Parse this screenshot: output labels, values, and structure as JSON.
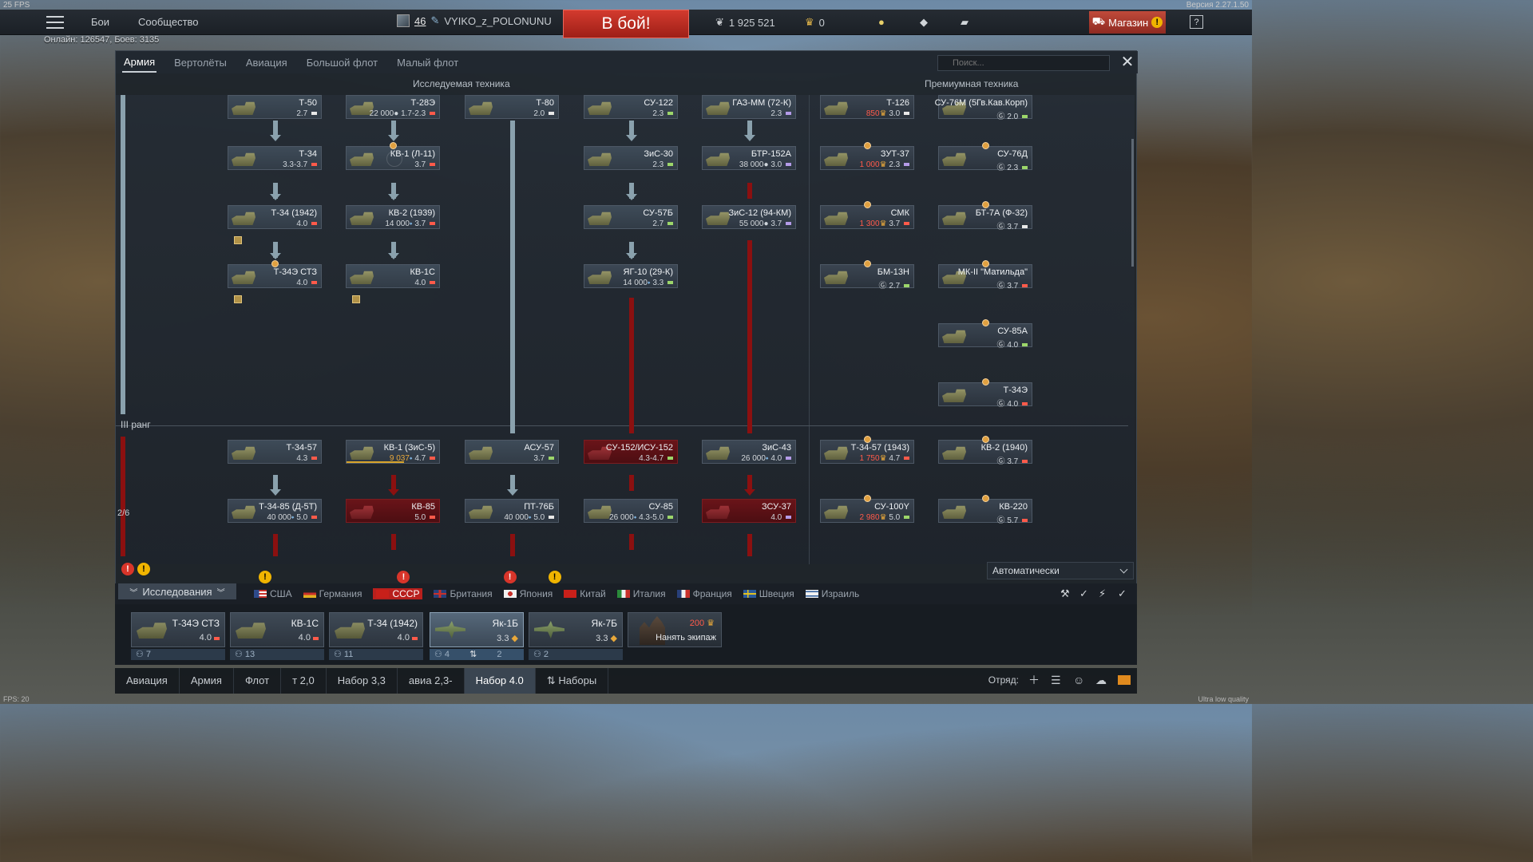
{
  "hud": {
    "fps": "25 FPS",
    "version": "Версия 2.27.1.50",
    "online": "Онлайн: 126547, Боев: 3135",
    "fps_bottom": "FPS: 20",
    "quality": "Ultra low quality"
  },
  "topbar": {
    "nav_battles": "Бои",
    "nav_community": "Сообщество",
    "player_level": "46",
    "player_name": "VYIKO_z_POLONUNU",
    "battle_button": "В бой!",
    "silver": "1 925 521",
    "gold": "0",
    "shop": "Магазин",
    "help": "?"
  },
  "window": {
    "tabs": [
      "Армия",
      "Вертолёты",
      "Авиация",
      "Большой флот",
      "Малый флот"
    ],
    "search_placeholder": "Поиск...",
    "close": "✕",
    "col_researched": "Исследуемая техника",
    "col_premium": "Премиумная техника",
    "rank_label": "III ранг",
    "rank_count": "2/6"
  },
  "tree": {
    "cards": [
      {
        "name": "Т-50",
        "cost": "",
        "br": "2.7"
      },
      {
        "name": "Т-28Э",
        "cost": "22 000",
        "br": "1.7-2.3"
      },
      {
        "name": "Т-80",
        "cost": "",
        "br": "2.0"
      },
      {
        "name": "СУ-122",
        "cost": "",
        "br": "2.3"
      },
      {
        "name": "ГАЗ-ММ (72-К)",
        "cost": "",
        "br": "2.3"
      },
      {
        "name": "Т-126",
        "cost": "850",
        "br": "3.0"
      },
      {
        "name": "СУ-76М (5Гв.Кав.Корп)",
        "cost": "",
        "br": "2.0"
      },
      {
        "name": "Т-34",
        "cost": "",
        "br": "3.3-3.7"
      },
      {
        "name": "КВ-1 (Л-11)",
        "cost": "",
        "br": "3.7"
      },
      {
        "name": "ЗиС-30",
        "cost": "",
        "br": "2.3"
      },
      {
        "name": "БТР-152А",
        "cost": "38 000",
        "br": "3.0"
      },
      {
        "name": "ЗУТ-37",
        "cost": "1 000",
        "br": "2.3"
      },
      {
        "name": "СУ-76Д",
        "cost": "",
        "br": "2.3"
      },
      {
        "name": "Т-34 (1942)",
        "cost": "",
        "br": "4.0"
      },
      {
        "name": "КВ-2 (1939)",
        "cost": "14 000",
        "br": "3.7"
      },
      {
        "name": "СУ-57Б",
        "cost": "",
        "br": "2.7"
      },
      {
        "name": "ЗиС-12 (94-КМ)",
        "cost": "55 000",
        "br": "3.7"
      },
      {
        "name": "СМК",
        "cost": "1 300",
        "br": "3.7"
      },
      {
        "name": "БТ-7А (Ф-32)",
        "cost": "",
        "br": "3.7"
      },
      {
        "name": "Т-34Э СТЗ",
        "cost": "",
        "br": "4.0"
      },
      {
        "name": "КВ-1С",
        "cost": "",
        "br": "4.0"
      },
      {
        "name": "ЯГ-10 (29-К)",
        "cost": "14 000",
        "br": "3.3"
      },
      {
        "name": "БМ-13Н",
        "cost": "",
        "br": "2.7"
      },
      {
        "name": "МК-II \"Матильда\"",
        "cost": "",
        "br": "3.7"
      },
      {
        "name": "СУ-85А",
        "cost": "",
        "br": "4.0"
      },
      {
        "name": "Т-34Э",
        "cost": "",
        "br": "4.0"
      },
      {
        "name": "Т-34-57",
        "cost": "",
        "br": "4.3"
      },
      {
        "name": "КВ-1 (ЗиС-5)",
        "cost": "9 037",
        "br": "4.7"
      },
      {
        "name": "АСУ-57",
        "cost": "",
        "br": "3.7"
      },
      {
        "name": "СУ-152/ИСУ-152",
        "cost": "",
        "br": "4.3-4.7"
      },
      {
        "name": "ЗиС-43",
        "cost": "26 000",
        "br": "4.0"
      },
      {
        "name": "Т-34-57 (1943)",
        "cost": "1 750",
        "br": "4.7"
      },
      {
        "name": "КВ-2 (1940)",
        "cost": "",
        "br": "3.7"
      },
      {
        "name": "Т-34-85 (Д-5Т)",
        "cost": "40 000",
        "br": "5.0"
      },
      {
        "name": "КВ-85",
        "cost": "",
        "br": "5.0"
      },
      {
        "name": "ПТ-76Б",
        "cost": "40 000",
        "br": "5.0"
      },
      {
        "name": "СУ-85",
        "cost": "26 000",
        "br": "4.3-5.0"
      },
      {
        "name": "ЗСУ-37",
        "cost": "",
        "br": "4.0"
      },
      {
        "name": "СУ-100Y",
        "cost": "2 980",
        "br": "5.0"
      },
      {
        "name": "КВ-220",
        "cost": "",
        "br": "5.7"
      }
    ]
  },
  "bottom": {
    "research_tab": "Исследования",
    "auto_select": "Автоматически",
    "nations": [
      "США",
      "Германия",
      "СССР",
      "Британия",
      "Япония",
      "Китай",
      "Италия",
      "Франция",
      "Швеция",
      "Израиль"
    ],
    "slots": [
      {
        "name": "Т-34Э СТЗ",
        "br": "4.0",
        "crew": "7"
      },
      {
        "name": "КВ-1С",
        "br": "4.0",
        "crew": "13"
      },
      {
        "name": "Т-34 (1942)",
        "br": "4.0",
        "crew": "11"
      },
      {
        "name": "Як-1Б",
        "br": "3.3",
        "crew": "4",
        "extra": "2"
      },
      {
        "name": "Як-7Б",
        "br": "3.3",
        "crew": "2"
      }
    ],
    "hire_price": "200",
    "hire_label": "Нанять экипаж",
    "bar": [
      "Авиация",
      "Армия",
      "Флот",
      "т 2,0",
      "Набор 3,3",
      "авиа 2,3-",
      "Набор 4.0",
      "Наборы"
    ],
    "squad_label": "Отряд:"
  },
  "colors": {
    "battle": "#c0302a",
    "ussr_active": "#b8201d",
    "locked_red": "#6a1419",
    "gold_cost": "#e8a83a",
    "lion_red": "#ff5a4a"
  }
}
